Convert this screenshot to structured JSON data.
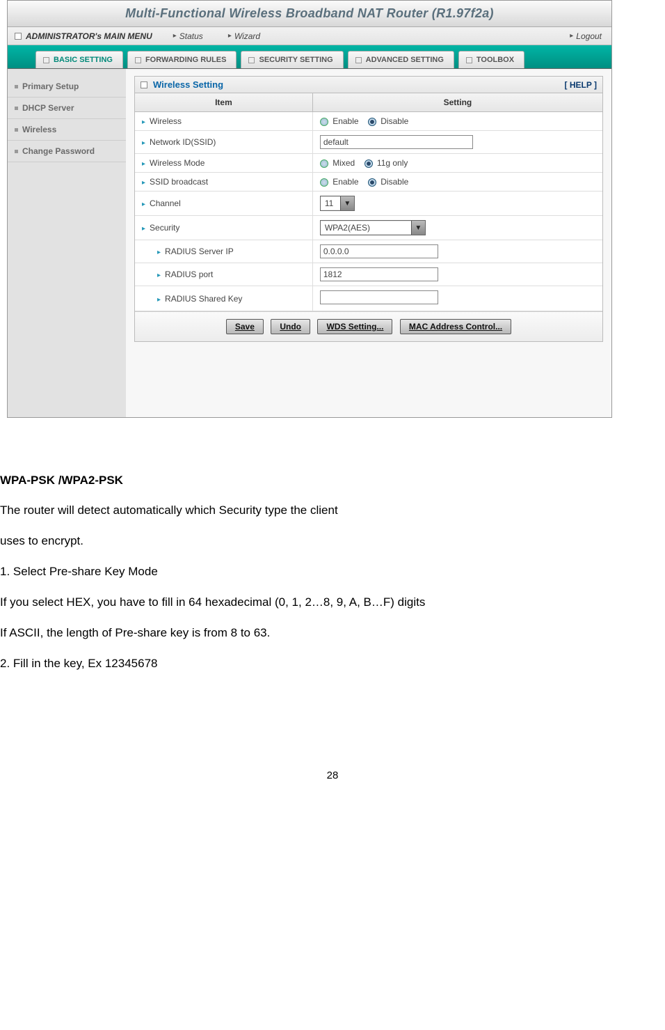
{
  "page_number": "28",
  "router": {
    "title": "Multi-Functional Wireless Broadband NAT Router (R1.97f2a)",
    "menubar": {
      "main": "ADMINISTRATOR's MAIN MENU",
      "status": "Status",
      "wizard": "Wizard",
      "logout": "Logout"
    },
    "tabs": {
      "basic": "BASIC SETTING",
      "forwarding": "FORWARDING RULES",
      "security": "SECURITY SETTING",
      "advanced": "ADVANCED SETTING",
      "toolbox": "TOOLBOX"
    },
    "sidebar": {
      "primary": "Primary Setup",
      "dhcp": "DHCP Server",
      "wireless": "Wireless",
      "changepw": "Change Password"
    },
    "panel": {
      "title": "Wireless Setting",
      "help": "[ HELP ]",
      "col_item": "Item",
      "col_setting": "Setting",
      "rows": {
        "wireless_label": "Wireless",
        "enable": "Enable",
        "disable": "Disable",
        "ssid_label": "Network ID(SSID)",
        "ssid_value": "default",
        "mode_label": "Wireless Mode",
        "mixed": "Mixed",
        "g_only": "11g only",
        "ssidb_label": "SSID broadcast",
        "channel_label": "Channel",
        "channel_value": "11",
        "security_label": "Security",
        "security_value": "WPA2(AES)",
        "radius_ip_label": "RADIUS Server IP",
        "radius_ip_value": "0.0.0.0",
        "radius_port_label": "RADIUS port",
        "radius_port_value": "1812",
        "radius_key_label": "RADIUS Shared Key",
        "radius_key_value": ""
      },
      "buttons": {
        "save": "Save",
        "undo": "Undo",
        "wds": "WDS Setting...",
        "mac": "MAC Address Control..."
      }
    }
  },
  "doc": {
    "heading": "WPA-PSK /WPA2-PSK",
    "p1": "The router will detect automatically    which Security type the client",
    "p2": "uses to encrypt.",
    "p3": "1. Select Pre-share Key Mode",
    "p4": "If you select HEX, you have to fill in 64 hexadecimal (0, 1, 2…8, 9, A, B…F) digits",
    "p5": "If ASCII, the length of Pre-share key is from 8 to 63.",
    "p6": "2. Fill in the key, Ex 12345678"
  }
}
